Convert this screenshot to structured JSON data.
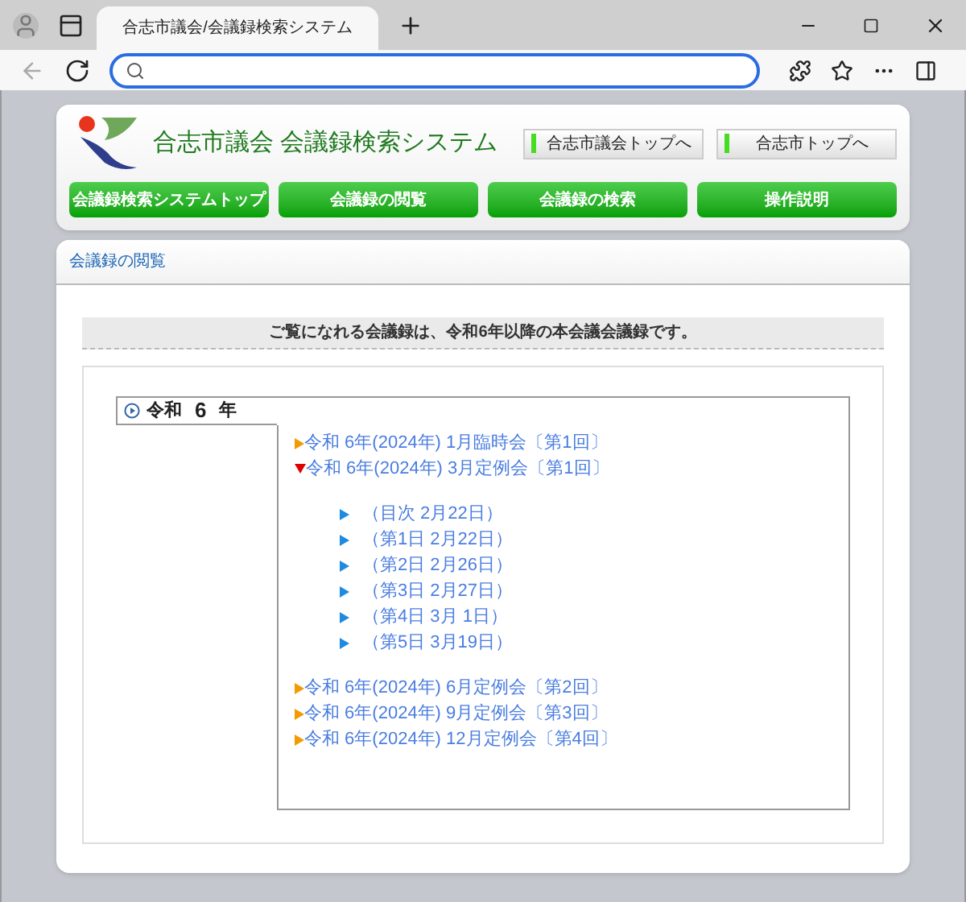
{
  "browser": {
    "tab_title": "合志市議会/会議録検索システム"
  },
  "header": {
    "site_title": "合志市議会 会議録検索システム",
    "links": [
      "合志市議会トップへ",
      "合志市トップへ"
    ],
    "nav": [
      "会議録検索システムトップ",
      "会議録の閲覧",
      "会議録の検索",
      "操作説明"
    ]
  },
  "panel": {
    "heading": "会議録の閲覧",
    "notice": "ご覧になれる会議録は、令和6年以降の本会議会議録です。",
    "year_tab": {
      "era": "令和",
      "year": "6",
      "suffix": "年"
    },
    "meetings": [
      {
        "title": "令和 6年(2024年) 1月臨時会〔第1回〕",
        "expanded": false
      },
      {
        "title": "令和 6年(2024年) 3月定例会〔第1回〕",
        "expanded": true,
        "children": [
          {
            "title": "（目次 2月22日）"
          },
          {
            "title": "（第1日 2月22日）"
          },
          {
            "title": "（第2日 2月26日）"
          },
          {
            "title": "（第3日 2月27日）"
          },
          {
            "title": "（第4日 3月 1日）"
          },
          {
            "title": "（第5日 3月19日）"
          }
        ]
      },
      {
        "title": "令和 6年(2024年) 6月定例会〔第2回〕",
        "expanded": false
      },
      {
        "title": "令和 6年(2024年) 9月定例会〔第3回〕",
        "expanded": false
      },
      {
        "title": "令和 6年(2024年) 12月定例会〔第4回〕",
        "expanded": false
      }
    ]
  }
}
